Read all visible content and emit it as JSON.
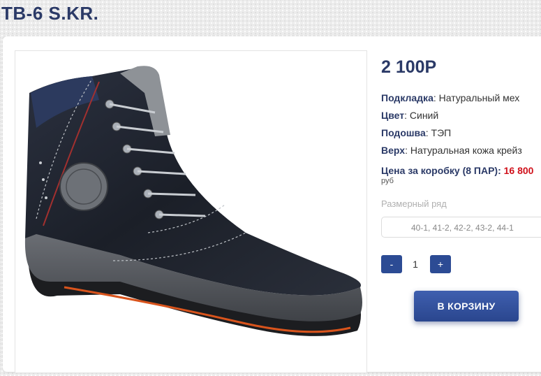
{
  "product": {
    "title": "ТВ-6 S.KR.",
    "price": "2 100Р",
    "image_alt": "boot-photo"
  },
  "attributes": [
    {
      "label": "Подкладка",
      "value": "Натуральный мех"
    },
    {
      "label": "Цвет",
      "value": "Синий"
    },
    {
      "label": "Подошва",
      "value": "ТЭП"
    },
    {
      "label": "Верх",
      "value": "Натуральная кожа крейз"
    }
  ],
  "box_price": {
    "label": "Цена за коробку (8 ПАР):",
    "value": "16 800",
    "unit": "руб"
  },
  "size_range": {
    "label": "Размерный ряд",
    "selected": "40-1, 41-2, 42-2, 43-2, 44-1"
  },
  "quantity": {
    "minus_label": "-",
    "value": "1",
    "plus_label": "+"
  },
  "cart_button": {
    "label": "В КОРЗИНУ"
  },
  "colors": {
    "title": "#2b3a67",
    "accent": "#2c4b94",
    "price_red": "#d0111b"
  }
}
